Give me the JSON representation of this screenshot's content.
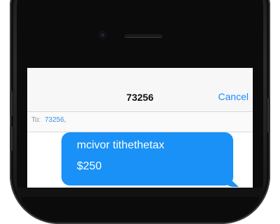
{
  "header": {
    "recipient_number": "73256",
    "cancel_label": "Cancel"
  },
  "to_field": {
    "label": "To:",
    "value": "73256,"
  },
  "message": {
    "line1": "mcivor tithethetax",
    "line2": "$250",
    "bubble_color": "#1a91f7"
  },
  "colors": {
    "accent": "#1a8cff",
    "frame": "#1b1b1d"
  }
}
